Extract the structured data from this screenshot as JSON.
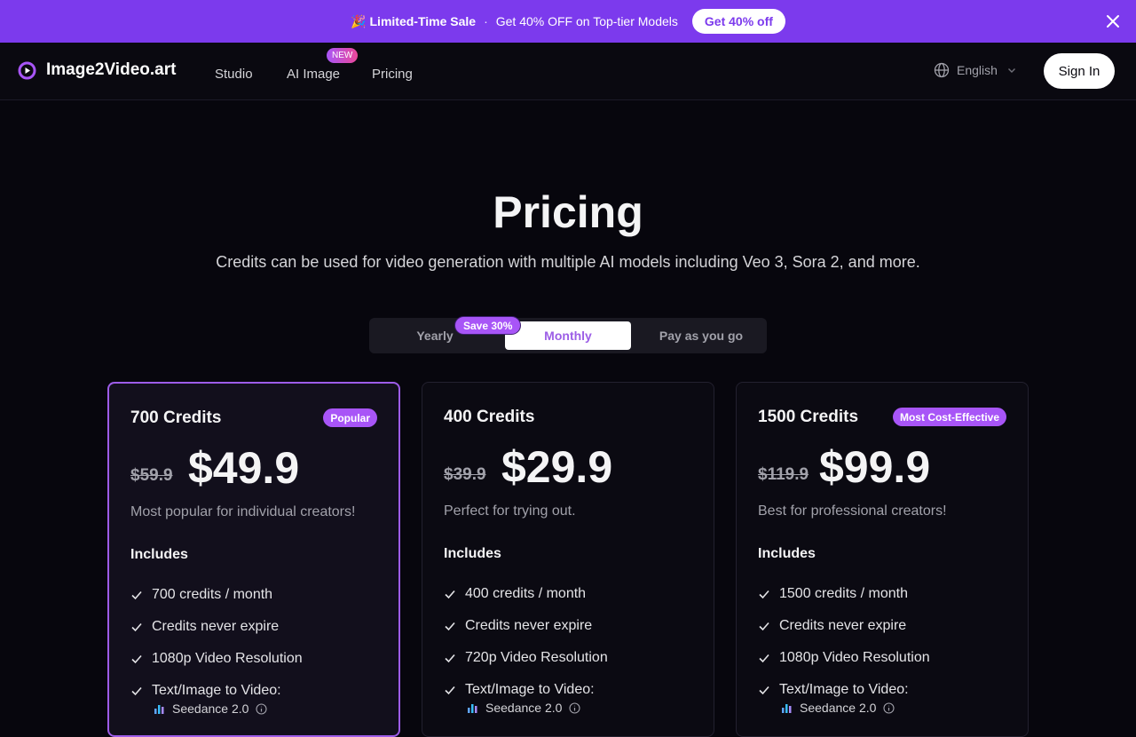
{
  "promo": {
    "emoji": "🎉",
    "sale_label": "Limited-Time Sale",
    "separator": "·",
    "text": "Get 40% OFF on Top-tier Models",
    "cta": "Get 40% off"
  },
  "nav": {
    "brand": "Image2Video.art",
    "links": [
      "Studio",
      "AI Image",
      "Pricing"
    ],
    "new_badge": "NEW",
    "language": "English",
    "sign_in": "Sign In"
  },
  "hero": {
    "title": "Pricing",
    "subtitle": "Credits can be used for video generation with multiple AI models including Veo 3, Sora 2, and more."
  },
  "billing_toggle": {
    "options": [
      "Yearly",
      "Monthly",
      "Pay as you go"
    ],
    "selected": "Monthly",
    "save_badge": "Save 30%"
  },
  "plans": [
    {
      "name": "700 Credits",
      "badge": "Popular",
      "old_price": "$59.9",
      "price": "$49.9",
      "description": "Most popular for individual creators!",
      "includes_label": "Includes",
      "features": [
        "700 credits / month",
        "Credits never expire",
        "1080p Video Resolution",
        "Text/Image to Video:"
      ],
      "model": "Seedance 2.0"
    },
    {
      "name": "400 Credits",
      "badge": "",
      "old_price": "$39.9",
      "price": "$29.9",
      "description": "Perfect for trying out.",
      "includes_label": "Includes",
      "features": [
        "400 credits / month",
        "Credits never expire",
        "720p Video Resolution",
        "Text/Image to Video:"
      ],
      "model": "Seedance 2.0"
    },
    {
      "name": "1500 Credits",
      "badge": "Most Cost-Effective",
      "old_price": "$119.9",
      "price": "$99.9",
      "description": "Best for professional creators!",
      "includes_label": "Includes",
      "features": [
        "1500 credits / month",
        "Credits never expire",
        "1080p Video Resolution",
        "Text/Image to Video:"
      ],
      "model": "Seedance 2.0"
    }
  ],
  "colors": {
    "accent": "#a855f7",
    "promo_bg": "#7c3aed",
    "page_bg": "#07060d"
  },
  "icons": {
    "close": "close-icon",
    "logo": "logo-icon",
    "globe": "globe-icon",
    "chevron": "chevron-down-icon",
    "check": "check-icon",
    "info": "info-icon",
    "model": "bar-chart-icon"
  }
}
